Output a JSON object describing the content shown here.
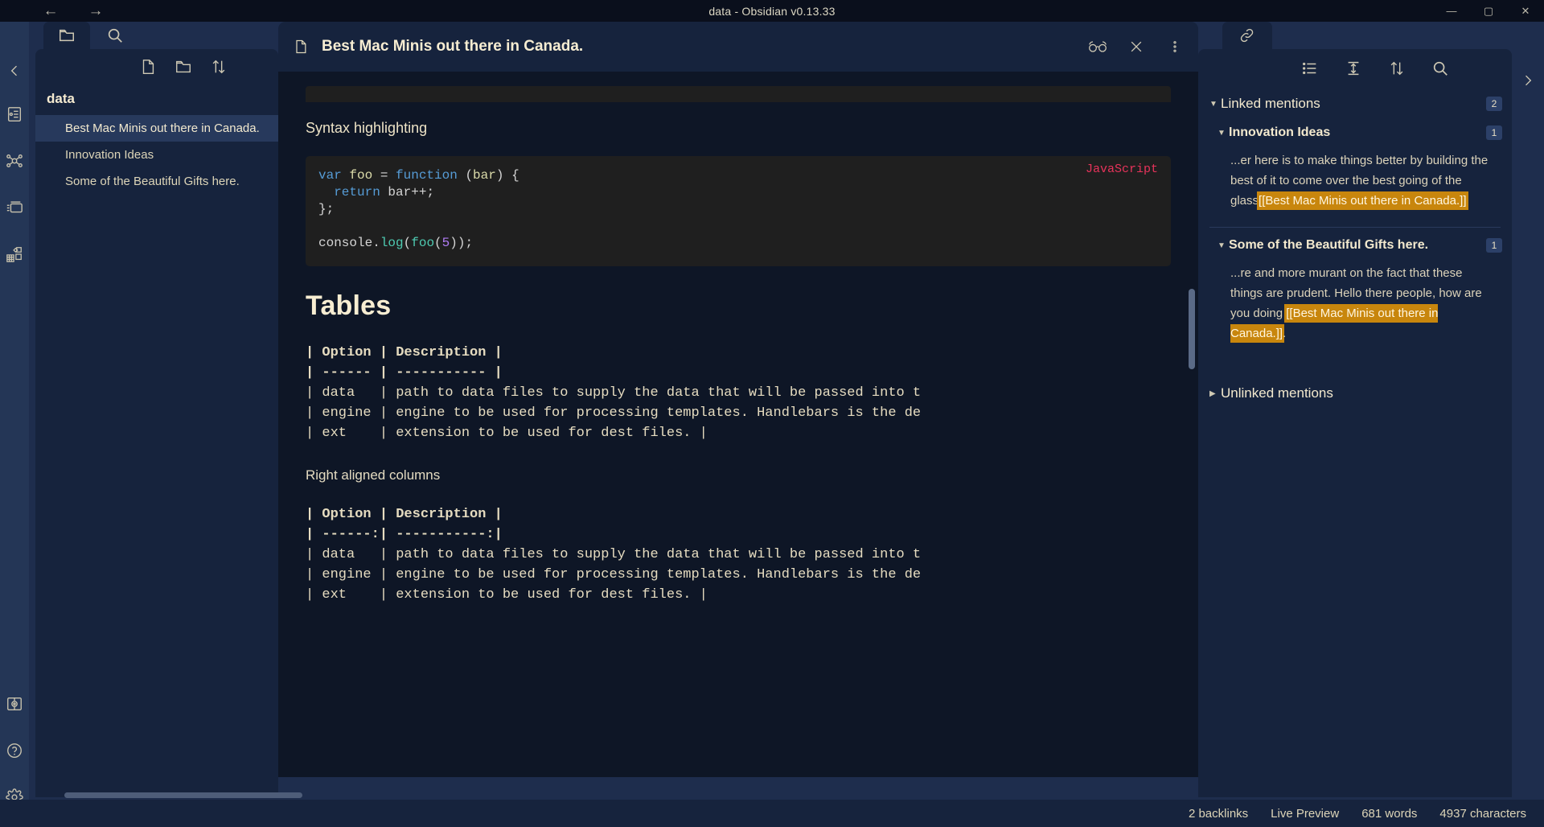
{
  "window": {
    "title": "data - Obsidian v0.13.33",
    "back_icon": "←",
    "forward_icon": "→",
    "minimize": "—",
    "maximize": "▢",
    "close": "✕"
  },
  "ribbon": {
    "collapse_icon": "chevron-left-icon",
    "items": [
      {
        "name": "open-daily-note",
        "icon": "note-panel-icon"
      },
      {
        "name": "open-graph-view",
        "icon": "graph-icon"
      },
      {
        "name": "open-canvas",
        "icon": "cards-icon"
      },
      {
        "name": "open-templates",
        "icon": "blocks-icon"
      }
    ],
    "bottom_items": [
      {
        "name": "open-another-vault",
        "icon": "vault-icon"
      },
      {
        "name": "help",
        "icon": "help-icon"
      },
      {
        "name": "settings",
        "icon": "gear-icon"
      }
    ]
  },
  "left_sidebar": {
    "tabs": [
      {
        "name": "file-explorer",
        "icon": "folder-icon",
        "active": true
      },
      {
        "name": "search",
        "icon": "search-icon",
        "active": false
      }
    ],
    "toolbar": [
      {
        "name": "new-note",
        "icon": "new-note-icon"
      },
      {
        "name": "new-folder",
        "icon": "new-folder-icon"
      },
      {
        "name": "change-sort-order",
        "icon": "sort-icon"
      }
    ],
    "vault_name": "data",
    "files": [
      {
        "label": "Best Mac Minis out there in Canada.",
        "active": true
      },
      {
        "label": "Innovation Ideas",
        "active": false
      },
      {
        "label": "Some of the Beautiful Gifts here.",
        "active": false
      }
    ]
  },
  "editor": {
    "doc_icon": "file-icon",
    "title": "Best Mac Minis out there in Canada.",
    "actions": [
      {
        "name": "reading-view-toggle",
        "icon": "glasses-icon"
      },
      {
        "name": "close-tab",
        "icon": "close-icon"
      },
      {
        "name": "more-options",
        "icon": "vertical-dots-icon"
      }
    ],
    "content": {
      "subheading_1": "Syntax highlighting",
      "code_lang": "JavaScript",
      "code_lines": [
        [
          {
            "t": "var ",
            "c": "kw"
          },
          {
            "t": "foo ",
            "c": "var"
          },
          {
            "t": "= ",
            "c": "plain"
          },
          {
            "t": "function ",
            "c": "kw"
          },
          {
            "t": "(",
            "c": "plain"
          },
          {
            "t": "bar",
            "c": "var"
          },
          {
            "t": ") {",
            "c": "plain"
          }
        ],
        [
          {
            "t": "  return ",
            "c": "kw"
          },
          {
            "t": "bar",
            "c": "plain"
          },
          {
            "t": "++;",
            "c": "plain"
          }
        ],
        [
          {
            "t": "};",
            "c": "plain"
          }
        ],
        [
          {
            "t": "",
            "c": "plain"
          }
        ],
        [
          {
            "t": "console.",
            "c": "plain"
          },
          {
            "t": "log",
            "c": "fn"
          },
          {
            "t": "(",
            "c": "plain"
          },
          {
            "t": "foo",
            "c": "fn"
          },
          {
            "t": "(",
            "c": "plain"
          },
          {
            "t": "5",
            "c": "num"
          },
          {
            "t": "));",
            "c": "plain"
          }
        ]
      ],
      "heading_tables": "Tables",
      "table_1": [
        "| Option | Description |",
        "| ------ | ----------- |",
        "| data   | path to data files to supply the data that will be passed into t",
        "| engine | engine to be used for processing templates. Handlebars is the de",
        "| ext    | extension to be used for dest files. |"
      ],
      "subheading_2": "Right aligned columns",
      "table_2": [
        "| Option | Description |",
        "| ------:| -----------:|",
        "| data   | path to data files to supply the data that will be passed into t",
        "| engine | engine to be used for processing templates. Handlebars is the de",
        "| ext    | extension to be used for dest files. |"
      ]
    }
  },
  "right_sidebar": {
    "tabs": [
      {
        "name": "backlinks",
        "icon": "backlink-icon",
        "active": true
      }
    ],
    "toolbar": [
      {
        "name": "collapse-results",
        "icon": "list-icon"
      },
      {
        "name": "show-more-context",
        "icon": "context-icon"
      },
      {
        "name": "change-sort-order",
        "icon": "sort-icon"
      },
      {
        "name": "search-backlinks",
        "icon": "search-icon"
      }
    ],
    "expand_icon": "chevron-right-icon",
    "linked": {
      "title": "Linked mentions",
      "count": "2",
      "expanded": true,
      "sources": [
        {
          "title": "Innovation Ideas",
          "count": "1",
          "expanded": true,
          "excerpt_pre": "...er here is to make things better by building the best of it to come over the best going of the glass",
          "excerpt_link": "[[Best Mac Minis out there in Canada.]]",
          "excerpt_post": ""
        },
        {
          "title": "Some of the Beautiful Gifts here.",
          "count": "1",
          "expanded": true,
          "excerpt_pre": "...re and more murant on the fact that these things are prudent. Hello there people, how are you doing ",
          "excerpt_link": "[[Best Mac Minis out there in Canada.]]",
          "excerpt_post": "."
        }
      ]
    },
    "unlinked": {
      "title": "Unlinked mentions",
      "expanded": false
    }
  },
  "statusbar": {
    "items": [
      {
        "name": "backlink-count",
        "label": "2 backlinks"
      },
      {
        "name": "editor-mode",
        "label": "Live Preview"
      },
      {
        "name": "word-count",
        "label": "681 words"
      },
      {
        "name": "character-count",
        "label": "4937 characters"
      }
    ]
  },
  "colors": {
    "accent": "#c8860d",
    "bg_app": "#1e2d4d",
    "bg_pane": "#16233d",
    "bg_editor": "#0e1626",
    "text": "#dcd3ba"
  }
}
